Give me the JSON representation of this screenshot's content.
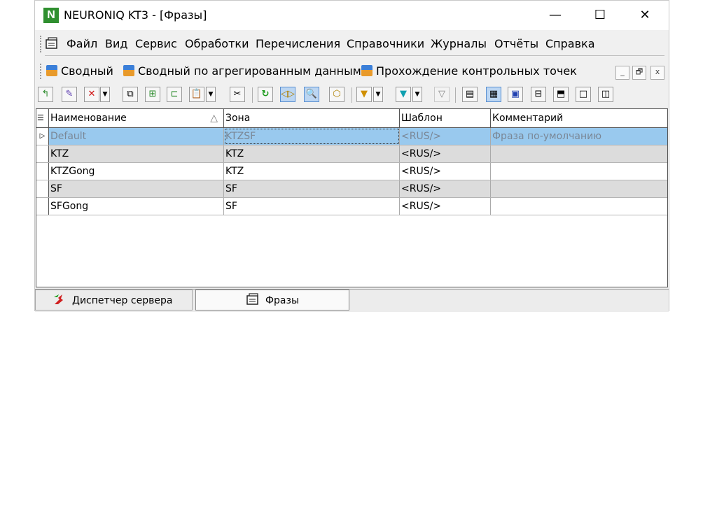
{
  "window": {
    "app_icon_letter": "N",
    "title": "NEURONIQ KT3 - [Фразы]",
    "minimize": "—",
    "maximize": "☐",
    "close": "✕"
  },
  "menu": {
    "items": [
      "Файл",
      "Вид",
      "Сервис",
      "Обработки",
      "Перечисления",
      "Справочники",
      "Журналы",
      "Отчёты",
      "Справка"
    ]
  },
  "quickbar": {
    "items": [
      "Сводный",
      "Сводный по агрегированным данным",
      "Прохождение контрольных точек"
    ],
    "mdi_min": "_",
    "mdi_restore": "🗗",
    "mdi_close": "x"
  },
  "grid": {
    "columns": [
      "Наименование",
      "Зона",
      "Шаблон",
      "Комментарий"
    ],
    "sort_indicator": "△",
    "rows": [
      {
        "name": "Default",
        "zone": "KTZSF",
        "template": "<RUS/>",
        "comment": "Фраза по-умолчанию"
      },
      {
        "name": "KTZ",
        "zone": "KTZ",
        "template": "<RUS/>",
        "comment": ""
      },
      {
        "name": "KTZGong",
        "zone": "KTZ",
        "template": "<RUS/>",
        "comment": ""
      },
      {
        "name": "SF",
        "zone": "SF",
        "template": "<RUS/>",
        "comment": ""
      },
      {
        "name": "SFGong",
        "zone": "SF",
        "template": "<RUS/>",
        "comment": ""
      }
    ]
  },
  "tabs": {
    "server_dispatcher": "Диспетчер сервера",
    "phrases": "Фразы"
  },
  "colors": {
    "selected_row": "#99c9ee",
    "alt_row": "#dcdcdc",
    "app_icon": "#2f8f2f"
  }
}
